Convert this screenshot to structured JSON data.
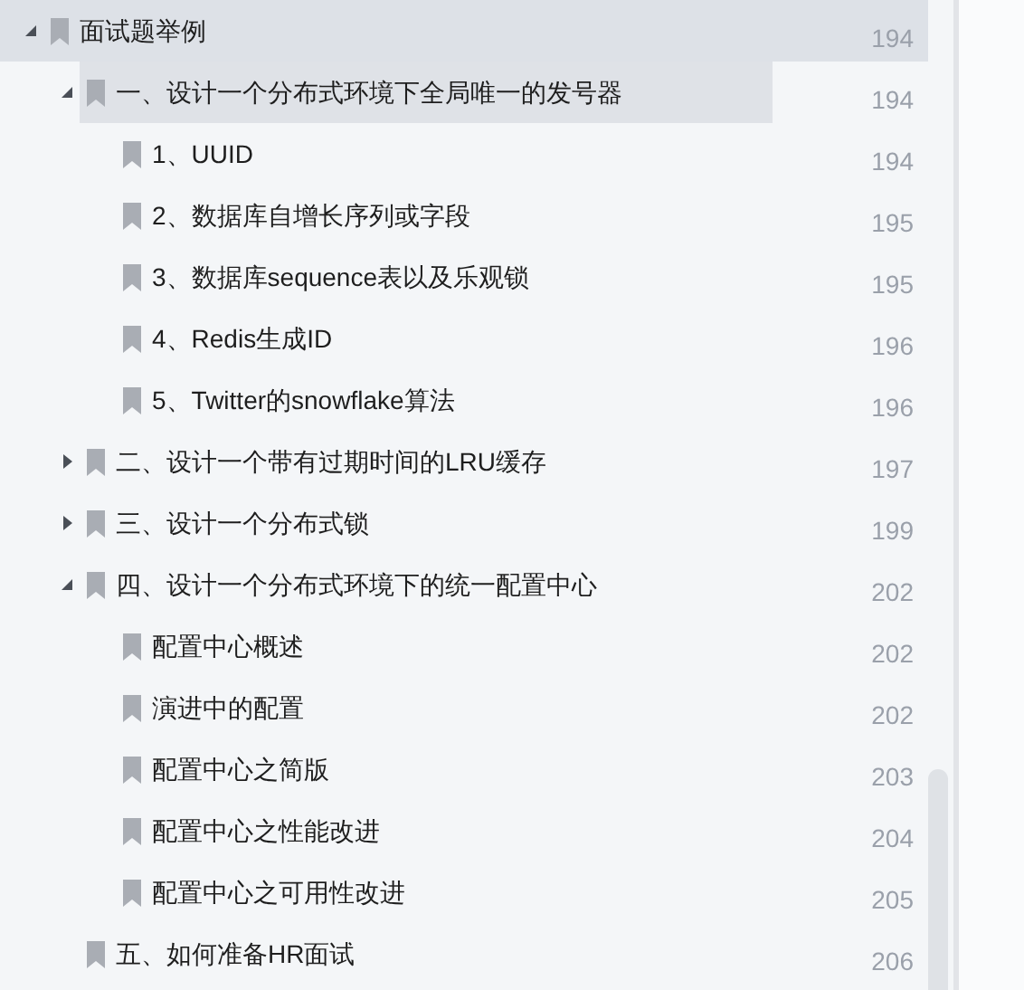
{
  "bookmarks": [
    {
      "label": "面试题举例",
      "page": "194",
      "expanded": true,
      "hovered": true,
      "selected": false,
      "children": [
        {
          "label": "一、设计一个分布式环境下全局唯一的发号器",
          "page": "194",
          "expanded": true,
          "hovered": false,
          "selected": true,
          "children": [
            {
              "label": "1、UUID",
              "page": "194",
              "hovered": false,
              "selected": false
            },
            {
              "label": "2、数据库自增长序列或字段",
              "page": "195",
              "hovered": false,
              "selected": false
            },
            {
              "label": "3、数据库sequence表以及乐观锁",
              "page": "195",
              "hovered": false,
              "selected": false
            },
            {
              "label": "4、Redis生成ID",
              "page": "196",
              "hovered": false,
              "selected": false
            },
            {
              "label": "5、Twitter的snowflake算法",
              "page": "196",
              "hovered": false,
              "selected": false
            }
          ]
        },
        {
          "label": "二、设计一个带有过期时间的LRU缓存",
          "page": "197",
          "expanded": false,
          "hovered": false,
          "selected": false
        },
        {
          "label": "三、设计一个分布式锁",
          "page": "199",
          "expanded": false,
          "hovered": false,
          "selected": false
        },
        {
          "label": "四、设计一个分布式环境下的统一配置中心",
          "page": "202",
          "expanded": true,
          "hovered": false,
          "selected": false,
          "children": [
            {
              "label": "配置中心概述",
              "page": "202",
              "hovered": false,
              "selected": false
            },
            {
              "label": "演进中的配置",
              "page": "202",
              "hovered": false,
              "selected": false
            },
            {
              "label": "配置中心之简版",
              "page": "203",
              "hovered": false,
              "selected": false
            },
            {
              "label": "配置中心之性能改进",
              "page": "204",
              "hovered": false,
              "selected": false
            },
            {
              "label": "配置中心之可用性改进",
              "page": "205",
              "hovered": false,
              "selected": false
            }
          ]
        },
        {
          "label": "五、如何准备HR面试",
          "page": "206",
          "hovered": false,
          "selected": false
        }
      ]
    }
  ]
}
